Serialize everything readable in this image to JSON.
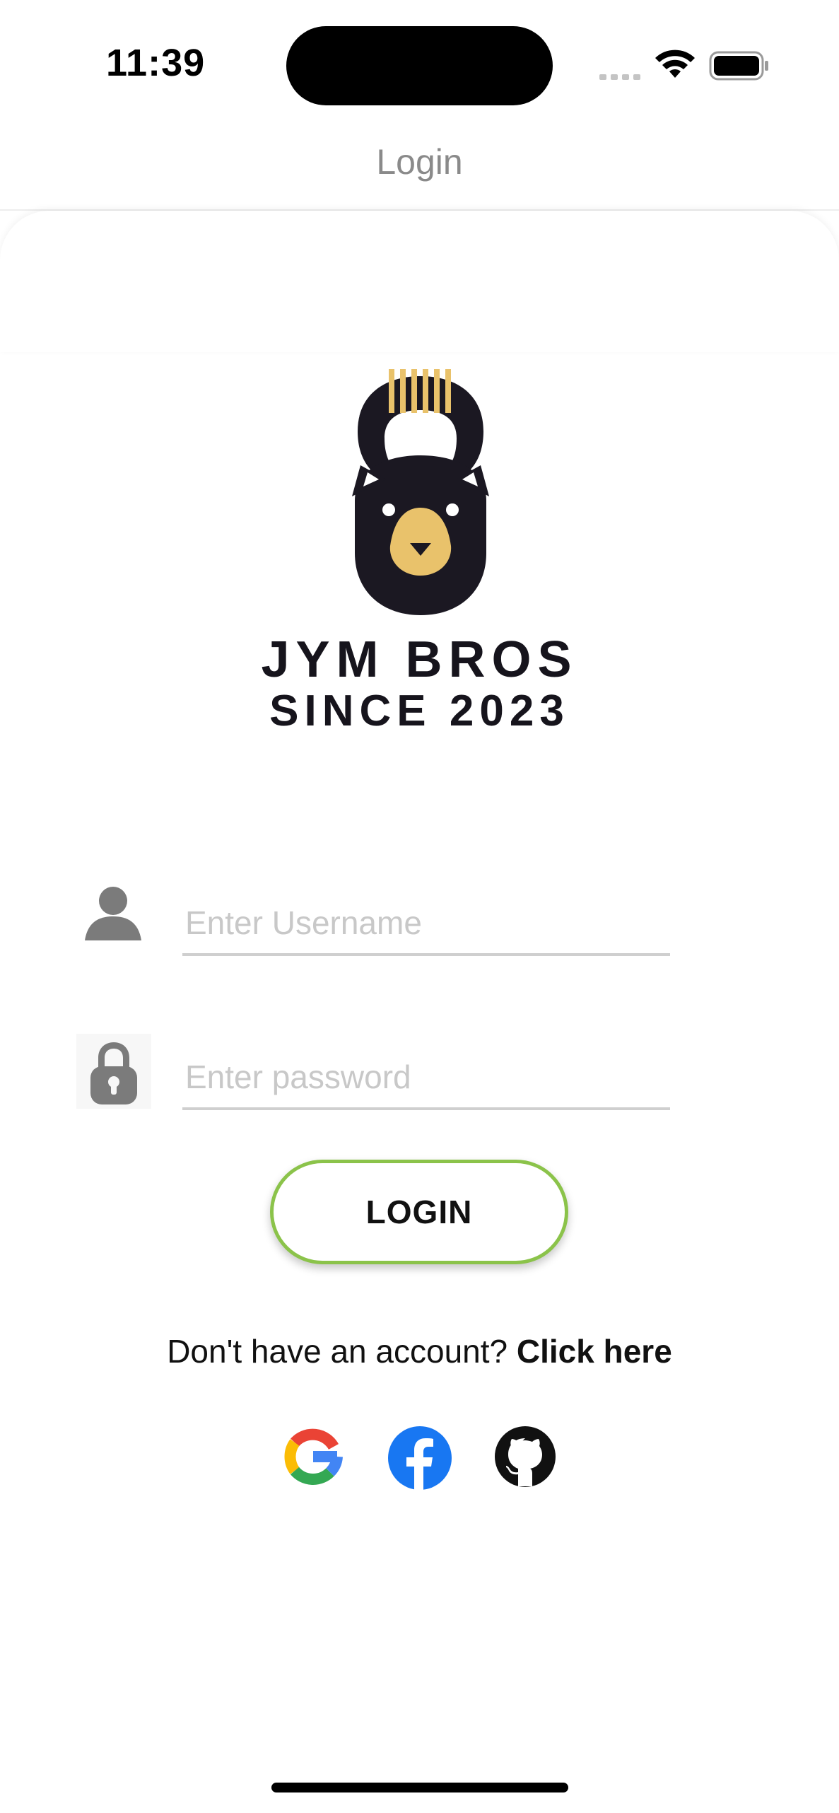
{
  "status_bar": {
    "time": "11:39",
    "icons": [
      "cellular-icon",
      "wifi-icon",
      "battery-icon"
    ]
  },
  "nav": {
    "title": "Login"
  },
  "logo": {
    "brand_name": "JYM BROS",
    "since": "SINCE 2023",
    "icon": "bear-kettlebell-logo",
    "colors": {
      "dark": "#1b1822",
      "gold": "#e9c26b"
    }
  },
  "form": {
    "username": {
      "placeholder": "Enter Username",
      "value": "",
      "icon": "user-icon"
    },
    "password": {
      "placeholder": "Enter password",
      "value": "",
      "icon": "lock-icon"
    },
    "login_label": "LOGIN"
  },
  "signup": {
    "prompt": "Don't have an account?",
    "link_label": "Click here"
  },
  "social": [
    {
      "name": "Google",
      "icon": "google-icon"
    },
    {
      "name": "Facebook",
      "icon": "facebook-icon",
      "color": "#1877f2"
    },
    {
      "name": "GitHub",
      "icon": "github-icon",
      "color": "#111111"
    }
  ],
  "colors": {
    "accent_border": "#8bc34a",
    "underline": "#cfcfcf",
    "placeholder": "#c8c8c8",
    "nav_title": "#8a8a8a"
  }
}
